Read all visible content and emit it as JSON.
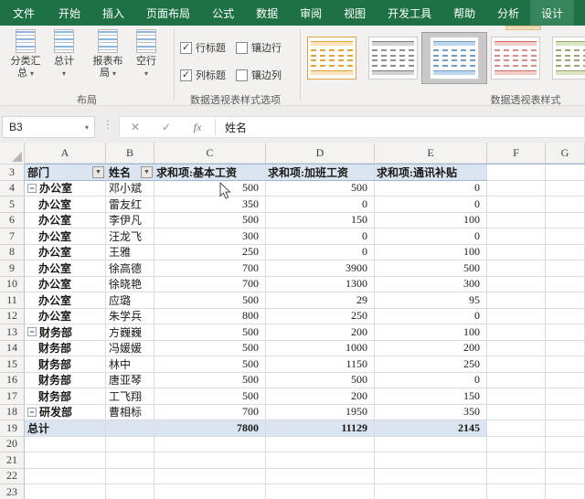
{
  "icons": {
    "collapse": "−",
    "filter": "▼",
    "caret": "▾",
    "dots": "⋮"
  },
  "colors": {
    "excel_green": "#1e7145",
    "active_tab_green": "#35845c",
    "pivot_header_fill": "#dbe5f1",
    "selected_style": "light-blue"
  },
  "tabbar": {
    "tabs": [
      {
        "label": "文件"
      },
      {
        "label": "开始"
      },
      {
        "label": "插入"
      },
      {
        "label": "页面布局"
      },
      {
        "label": "公式"
      },
      {
        "label": "数据"
      },
      {
        "label": "审阅"
      },
      {
        "label": "视图"
      },
      {
        "label": "开发工具"
      },
      {
        "label": "帮助"
      },
      {
        "label": "分析"
      },
      {
        "label": "设计"
      }
    ],
    "active": "设计"
  },
  "ribbon": {
    "layout_group": {
      "label": "布局",
      "buttons": [
        {
          "l1": "分类汇",
          "l2": "总"
        },
        {
          "l1": "总计",
          "l2": ""
        },
        {
          "l1": "报表布",
          "l2": "局"
        },
        {
          "l1": "空行",
          "l2": ""
        }
      ]
    },
    "options_group": {
      "label": "数据透视表样式选项",
      "checkboxes": [
        {
          "label": "行标题",
          "mark": "✓"
        },
        {
          "label": "镶边行",
          "mark": ""
        },
        {
          "label": "列标题",
          "mark": "✓"
        },
        {
          "label": "镶边列",
          "mark": ""
        }
      ]
    },
    "styles_group": {
      "label": "数据透视表样式"
    }
  },
  "formula_bar": {
    "name_box": "B3",
    "cancel": "✕",
    "enter": "✓",
    "fx": "fx",
    "value": "姓名"
  },
  "sheet": {
    "col_letters": [
      "A",
      "B",
      "C",
      "D",
      "E",
      "F",
      "G"
    ],
    "header_row": {
      "num": "3",
      "dept": "部门",
      "name": "姓名",
      "c1": "求和项:基本工资",
      "c2": "求和项:加班工资",
      "c3": "求和项:通讯补贴"
    },
    "rows": [
      {
        "num": "4",
        "dept": "办公室",
        "name": "邓小斌",
        "base": "500",
        "ot": "500",
        "comm": "0"
      },
      {
        "num": "5",
        "dept": "办公室",
        "name": "雷友红",
        "base": "350",
        "ot": "0",
        "comm": "0"
      },
      {
        "num": "6",
        "dept": "办公室",
        "name": "李伊凡",
        "base": "500",
        "ot": "150",
        "comm": "100"
      },
      {
        "num": "7",
        "dept": "办公室",
        "name": "汪龙飞",
        "base": "300",
        "ot": "0",
        "comm": "0"
      },
      {
        "num": "8",
        "dept": "办公室",
        "name": "王雅",
        "base": "250",
        "ot": "0",
        "comm": "100"
      },
      {
        "num": "9",
        "dept": "办公室",
        "name": "徐高德",
        "base": "700",
        "ot": "3900",
        "comm": "500"
      },
      {
        "num": "10",
        "dept": "办公室",
        "name": "徐晓艳",
        "base": "700",
        "ot": "1300",
        "comm": "300"
      },
      {
        "num": "11",
        "dept": "办公室",
        "name": "应璐",
        "base": "500",
        "ot": "29",
        "comm": "95"
      },
      {
        "num": "12",
        "dept": "办公室",
        "name": "朱学兵",
        "base": "800",
        "ot": "250",
        "comm": "0"
      },
      {
        "num": "13",
        "dept": "财务部",
        "name": "方巍巍",
        "base": "500",
        "ot": "200",
        "comm": "100"
      },
      {
        "num": "14",
        "dept": "财务部",
        "name": "冯媛媛",
        "base": "500",
        "ot": "1000",
        "comm": "200"
      },
      {
        "num": "15",
        "dept": "财务部",
        "name": "林中",
        "base": "500",
        "ot": "1150",
        "comm": "250"
      },
      {
        "num": "16",
        "dept": "财务部",
        "name": "唐亚琴",
        "base": "500",
        "ot": "500",
        "comm": "0"
      },
      {
        "num": "17",
        "dept": "财务部",
        "name": "工飞翔",
        "base": "500",
        "ot": "200",
        "comm": "150"
      },
      {
        "num": "18",
        "dept": "研发部",
        "name": "曹相标",
        "base": "700",
        "ot": "1950",
        "comm": "350"
      }
    ],
    "total_row": {
      "num": "19",
      "label": "总计",
      "base": "7800",
      "ot": "11129",
      "comm": "2145"
    },
    "empty_rows": [
      {
        "num": "20"
      },
      {
        "num": "21"
      },
      {
        "num": "22"
      },
      {
        "num": "23"
      }
    ]
  }
}
